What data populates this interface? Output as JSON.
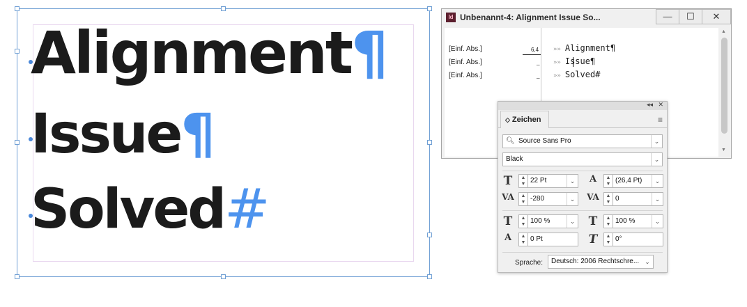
{
  "canvas": {
    "lines": [
      {
        "text": "Alignment",
        "mark": "¶"
      },
      {
        "text": "Issue",
        "mark": "¶"
      },
      {
        "text": "Solved",
        "mark": "#"
      }
    ]
  },
  "story_editor": {
    "app_icon": "Id",
    "title": "Unbenannt-4: Alignment  Issue  So...",
    "window_buttons": {
      "minimize": "—",
      "maximize": "☐",
      "close": "✕"
    },
    "rows": [
      {
        "style": "[Einf. Abs.]",
        "depth": "6,4",
        "text": "Alignment¶"
      },
      {
        "style": "[Einf. Abs.]",
        "depth": "_",
        "text": "Issue¶"
      },
      {
        "style": "[Einf. Abs.]",
        "depth": "_",
        "text": "Solved#"
      }
    ],
    "chevron": "»»"
  },
  "char_panel": {
    "collapse": "◂◂",
    "close": "✕",
    "tab_label": "Zeichen",
    "tab_icon": "◇",
    "menu_icon": "≡",
    "font_family": "Source Sans Pro",
    "font_style": "Black",
    "font_size": "22 Pt",
    "leading": "(26,4 Pt)",
    "kerning": "-280",
    "tracking": "0",
    "vertical_scale": "100 %",
    "horizontal_scale": "100 %",
    "baseline_shift": "0 Pt",
    "skew": "0°",
    "language_label": "Sprache:",
    "language_value": "Deutsch: 2006 Rechtschre...",
    "icons": [
      "search-icon",
      "font-size-icon",
      "leading-icon",
      "kerning-icon",
      "tracking-icon",
      "vertical-scale-icon",
      "horizontal-scale-icon",
      "baseline-shift-icon",
      "skew-icon"
    ]
  }
}
